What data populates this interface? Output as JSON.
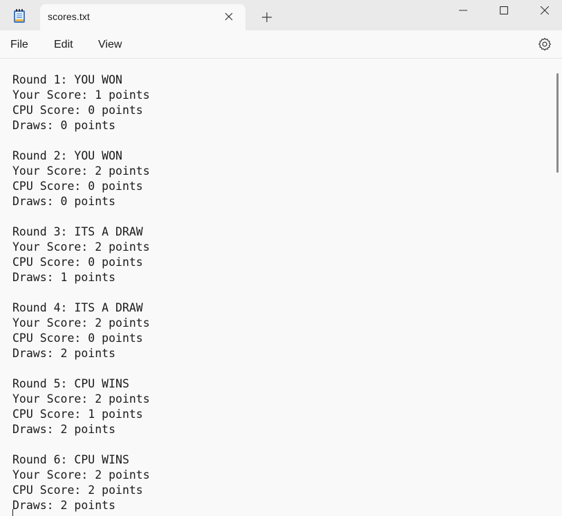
{
  "window": {
    "tab_title": "scores.txt",
    "app_icon": "notepad-icon",
    "controls": {
      "minimize": "minimize-icon",
      "maximize": "maximize-icon",
      "close": "close-icon"
    },
    "new_tab_icon": "plus-icon",
    "tab_close_icon": "close-icon"
  },
  "menu": {
    "items": [
      "File",
      "Edit",
      "View"
    ],
    "settings_icon": "gear-icon"
  },
  "editor": {
    "blocks": [
      {
        "round": "Round 1: YOU WON",
        "your": "Your Score: 1 points",
        "cpu": "CPU Score: 0 points",
        "draws": "Draws: 0 points"
      },
      {
        "round": "Round 2: YOU WON",
        "your": "Your Score: 2 points",
        "cpu": "CPU Score: 0 points",
        "draws": "Draws: 0 points"
      },
      {
        "round": "Round 3: ITS A DRAW",
        "your": "Your Score: 2 points",
        "cpu": "CPU Score: 0 points",
        "draws": "Draws: 1 points"
      },
      {
        "round": "Round 4: ITS A DRAW",
        "your": "Your Score: 2 points",
        "cpu": "CPU Score: 0 points",
        "draws": "Draws: 2 points"
      },
      {
        "round": "Round 5: CPU WINS",
        "your": "Your Score: 2 points",
        "cpu": "CPU Score: 1 points",
        "draws": "Draws: 2 points"
      },
      {
        "round": "Round 6: CPU WINS",
        "your": "Your Score: 2 points",
        "cpu": "CPU Score: 2 points",
        "draws": "Draws: 2 points"
      }
    ]
  }
}
